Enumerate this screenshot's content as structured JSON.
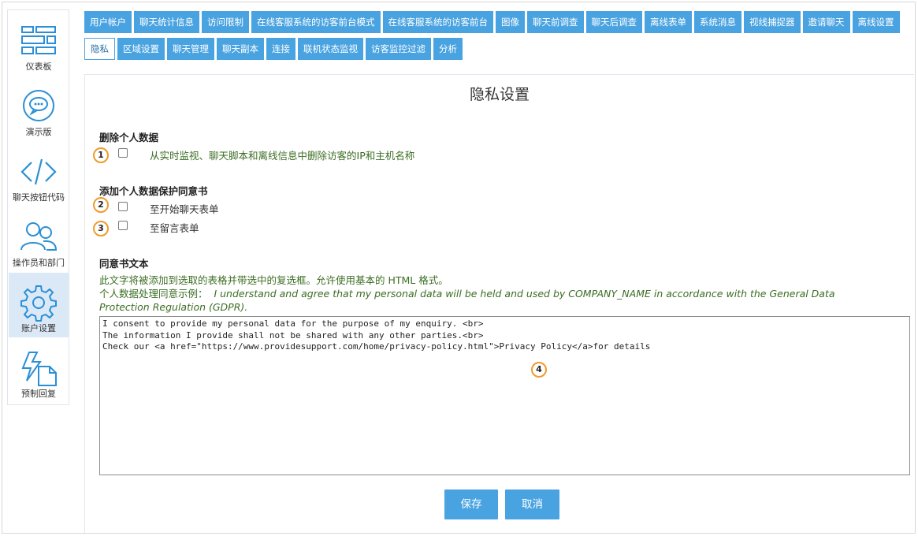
{
  "sidebar": {
    "items": [
      {
        "label": "仪表板",
        "icon": "dashboard-icon",
        "active": false
      },
      {
        "label": "演示版",
        "icon": "chat-bubble-icon",
        "active": false
      },
      {
        "label": "聊天按钮代码",
        "icon": "code-icon",
        "active": false
      },
      {
        "label": "操作员和部门",
        "icon": "users-icon",
        "active": false
      },
      {
        "label": "账户设置",
        "icon": "gear-icon",
        "active": true
      },
      {
        "label": "预制回复",
        "icon": "canned-reply-icon",
        "active": false
      }
    ]
  },
  "tabs": {
    "row1": [
      "用户帐户",
      "聊天统计信息",
      "访问限制",
      "在线客服系统的访客前台模式",
      "在线客服系统的访客前台",
      "图像",
      "聊天前调查",
      "聊天后调查",
      "离线表单",
      "系统消息",
      "视线捕捉器",
      "邀请聊天",
      "离线设置"
    ],
    "row2": [
      "隐私",
      "区域设置",
      "聊天管理",
      "聊天副本",
      "连接",
      "联机状态监视",
      "访客监控过滤",
      "分析"
    ],
    "active": "隐私"
  },
  "page": {
    "title": "隐私设置",
    "remove_section": {
      "heading": "删除个人数据",
      "option_label": "从实时监视、聊天脚本和离线信息中删除访客的IP和主机名称",
      "checked": false
    },
    "consent_section": {
      "heading": "添加个人数据保护同意书",
      "options": [
        {
          "label": "至开始聊天表单",
          "checked": false
        },
        {
          "label": "至留言表单",
          "checked": false
        }
      ]
    },
    "text_section": {
      "heading": "同意书文本",
      "description": "此文字将被添加到选取的表格并带选中的复选框。允许使用基本的 HTML 格式。",
      "example_prefix": "个人数据处理同意示例：",
      "example_text": "I understand and agree that my personal data will be held and used by COMPANY_NAME in accordance with the General Data Protection Regulation (GDPR).",
      "textarea_value": "I consent to provide my personal data for the purpose of my enquiry. <br>\nThe information I provide shall not be shared with any other parties.<br>\nCheck our <a href=\"https://www.providesupport.com/home/privacy-policy.html\">Privacy Policy</a>for details"
    },
    "buttons": {
      "save": "保存",
      "cancel": "取消"
    }
  },
  "annotations": [
    "1",
    "2",
    "3",
    "4"
  ],
  "colors": {
    "accent": "#4aa3e1",
    "badge_border": "#f09a2c",
    "green_text": "#3b6d22",
    "active_side": "#dbe9f7"
  }
}
